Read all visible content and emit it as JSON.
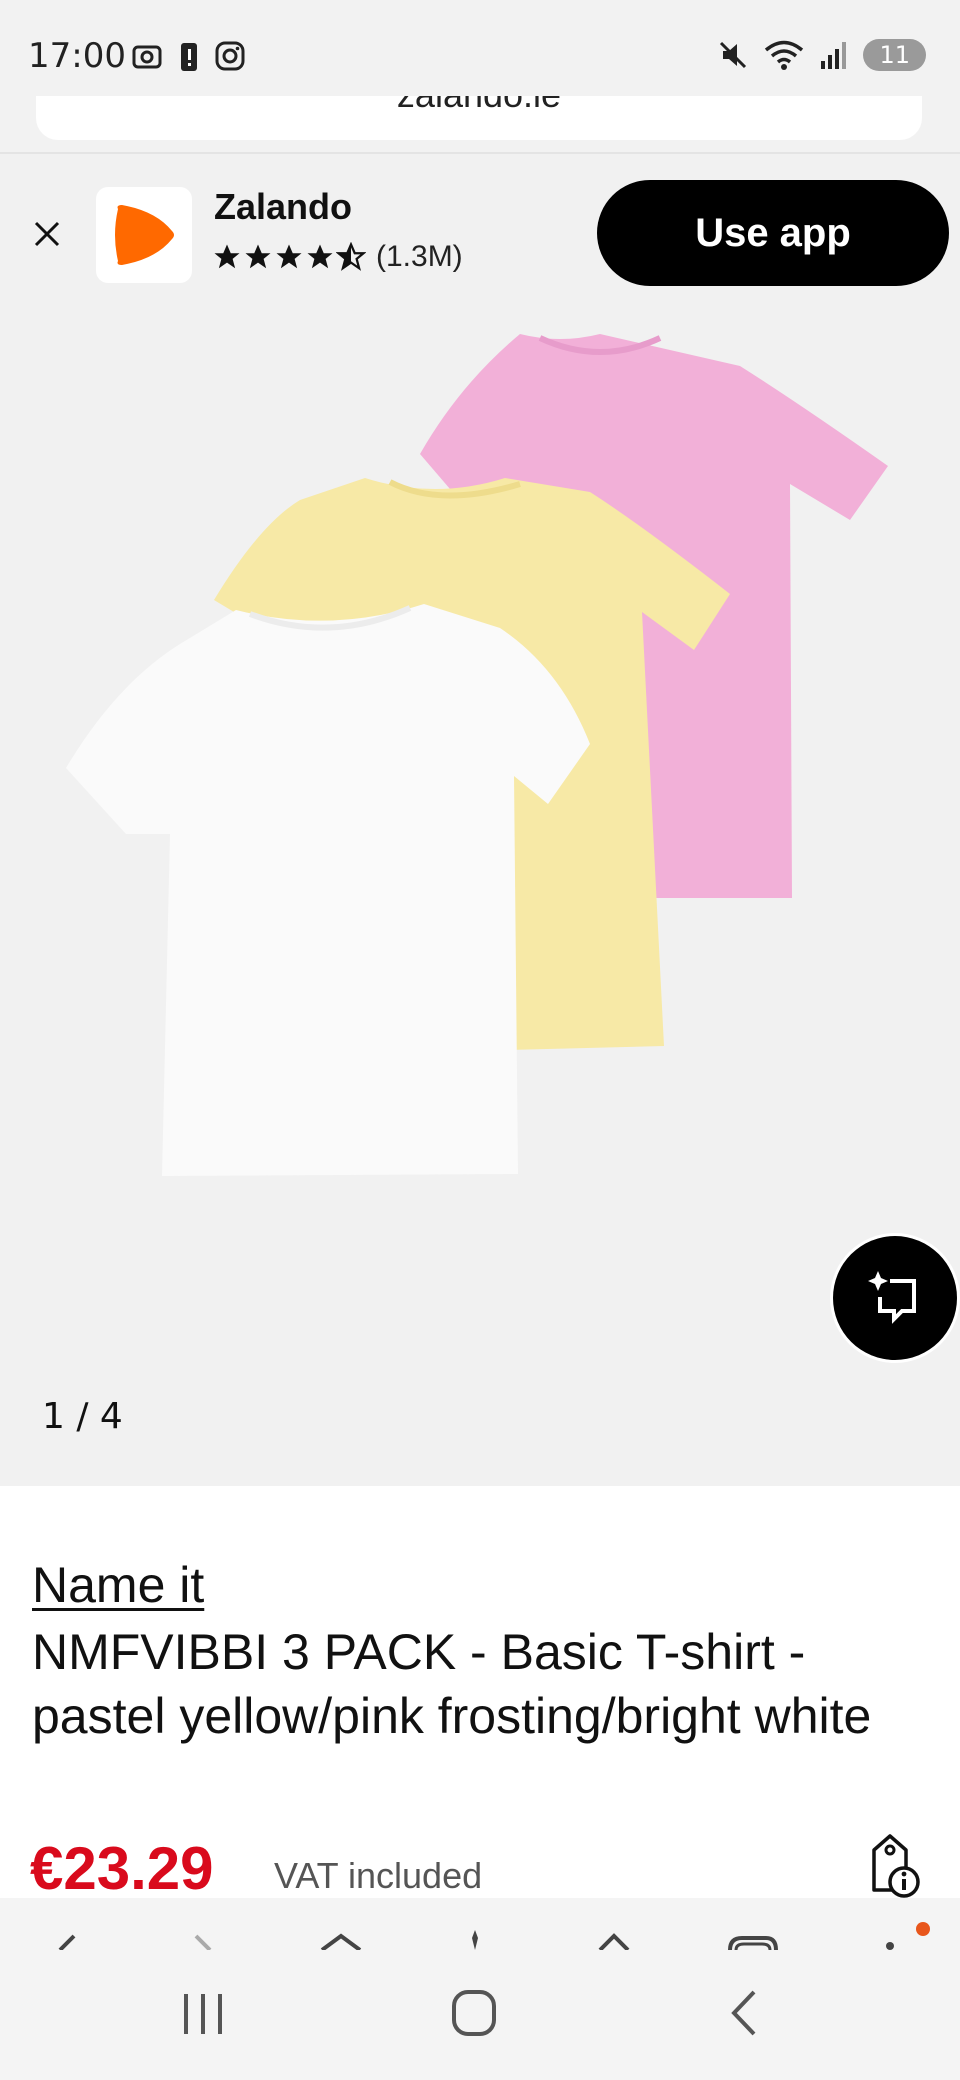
{
  "status_bar": {
    "time": "17:00",
    "battery": "11",
    "left_icons": [
      "screenshot-icon",
      "alert-icon",
      "instagram-icon"
    ],
    "right_icons": [
      "mute-icon",
      "wifi-icon",
      "signal-icon"
    ]
  },
  "browser": {
    "url_text": "zalando.ie"
  },
  "app_banner": {
    "app_name": "Zalando",
    "rating_stars": 4.5,
    "rating_count": "(1.3M)",
    "cta_label": "Use app",
    "brand_color": "#ff6900"
  },
  "gallery": {
    "pager": "1 / 4",
    "shirt_colors": [
      "#f2b0d8",
      "#f7e9a6",
      "#fafafa"
    ]
  },
  "product": {
    "brand": "Name it",
    "title": "NMFVIBBI 3 PACK - Basic T-shirt - pastel yellow/pink frosting/bright white",
    "price": "€23.29",
    "vat_note": "VAT included",
    "price_color": "#d90a1c"
  },
  "bottom_nav": {
    "items": [
      "back-icon",
      "forward-icon",
      "home-icon",
      "assistant-icon",
      "share-icon",
      "tabs-icon",
      "menu-icon"
    ],
    "notification_color": "#e8561b"
  },
  "system_nav": {
    "items": [
      "recents-icon",
      "home-button-icon",
      "back-button-icon"
    ]
  }
}
